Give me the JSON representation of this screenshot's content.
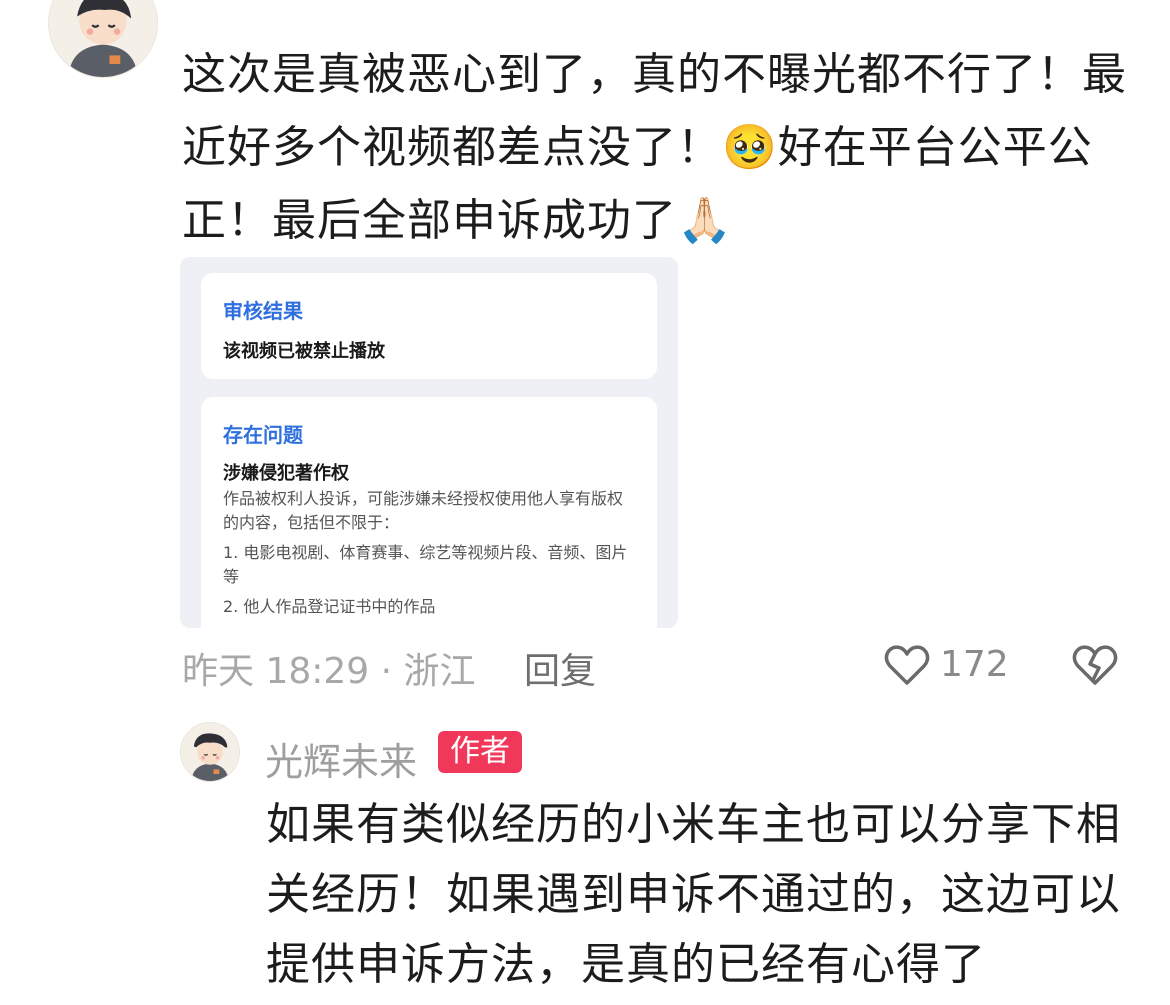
{
  "comment": {
    "avatar_icon": "user-avatar-icon",
    "text_part1": "这次是真被恶心到了，真的不曝光都不行了！最近好多个视频都差点没了！",
    "emoji1": "🥹",
    "text_part2": "好在平台公平公正！最后全部申诉成功了",
    "emoji2": "🙏🏻",
    "image": {
      "review_title": "审核结果",
      "review_result": "该视频已被禁止播放",
      "issue_title": "存在问题",
      "issue_name": "涉嫌侵犯著作权",
      "issue_desc": "作品被权利人投诉，可能涉嫌未经授权使用他人享有版权的内容，包括但不限于：",
      "issue_item1": "1. 电影电视剧、体育赛事、综艺等视频片段、音频、图片等",
      "issue_item2": "2. 他人作品登记证书中的作品"
    },
    "time_location": "昨天 18:29 · 浙江",
    "reply_label": "回复",
    "like_count": "172",
    "like_icon": "heart-outline-icon",
    "dislike_icon": "broken-heart-icon"
  },
  "reply": {
    "avatar_icon": "user-avatar-icon",
    "author_name": "光辉未来",
    "author_tag": "作者",
    "text": "如果有类似经历的小米车主也可以分享下相关经历！如果遇到申诉不通过的，这边可以提供申诉方法，是真的已经有心得了"
  },
  "colors": {
    "accent_blue": "#2f6fe0",
    "author_tag_bg": "#f2385a",
    "meta_gray": "#a8a8a8"
  }
}
